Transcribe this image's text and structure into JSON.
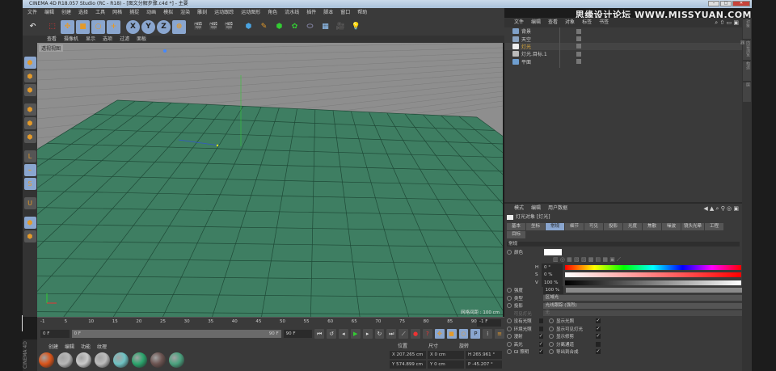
{
  "window": {
    "title": "CINEMA 4D R18.057 Studio (RC - R18) - [图文分解步骤.c4d *] - 主要",
    "watermark": "思缘设计论坛 WWW.MISSYUAN.COM"
  },
  "menu": [
    "文件",
    "编辑",
    "创建",
    "选择",
    "工具",
    "网格",
    "捕捉",
    "动画",
    "模拟",
    "渲染",
    "雕刻",
    "运动跟踪",
    "运动图形",
    "角色",
    "流水线",
    "插件",
    "脚本",
    "窗口",
    "帮助"
  ],
  "toolbar": {
    "axes": [
      "X",
      "Y",
      "Z"
    ],
    "icons": [
      "undo-icon",
      "live-select-icon",
      "move-icon",
      "scale-icon",
      "rotate-icon",
      "add-icon",
      "x-axis-icon",
      "y-axis-icon",
      "z-axis-icon",
      "world-coord-icon",
      "render-view-icon",
      "render-picture-icon",
      "render-settings-icon",
      "cube-icon",
      "pen-icon",
      "subdivision-icon",
      "array-icon",
      "deformer-icon",
      "floor-icon",
      "camera-icon",
      "light-icon"
    ]
  },
  "viewport": {
    "menu": [
      "查看",
      "摄像机",
      "显示",
      "选项",
      "过滤",
      "面板"
    ],
    "label": "透视视图",
    "grid_spacing": "网格间距 : 100 cm",
    "colors": {
      "sky": "#8e8e8e",
      "plane": "#3e7e62"
    }
  },
  "timeline": {
    "ticks": [
      "-1",
      "5",
      "10",
      "15",
      "20",
      "25",
      "30",
      "35",
      "40",
      "45",
      "50",
      "55",
      "60",
      "65",
      "70",
      "75",
      "80",
      "85",
      "90"
    ],
    "current_frame": "-1 F",
    "start": "0 F",
    "range_start": "0 F",
    "range_end": "90 F",
    "end": "90 F"
  },
  "materials": {
    "menu": [
      "创建",
      "编辑",
      "功能",
      "纹理"
    ],
    "swatches": [
      "#d9541a",
      "#b7b7b7",
      "#c9c9c9",
      "#bcbcbc",
      "#6fc3c4",
      "#2aa46c",
      "#6b5350",
      "#4aa17e"
    ]
  },
  "coordinates": {
    "headers": [
      "位置",
      "尺寸",
      "旋转"
    ],
    "rows": [
      {
        "a": "X",
        "pos": "207.265 cm",
        "b": "X",
        "size": "0 cm",
        "c": "H",
        "rot": "265.961 °"
      },
      {
        "a": "Y",
        "pos": "574.899 cm",
        "b": "Y",
        "size": "0 cm",
        "c": "P",
        "rot": "-45.207 °"
      }
    ]
  },
  "objects": {
    "menu": [
      "文件",
      "编辑",
      "查看",
      "对象",
      "标签",
      "书签"
    ],
    "items": [
      {
        "name": "背景",
        "color": "#7fa0c8",
        "selected": false
      },
      {
        "name": "天空",
        "color": "#8aa2c0",
        "selected": false
      },
      {
        "name": "灯光",
        "color": "#eeeeee",
        "selected": true
      },
      {
        "name": "灯光.目标.1",
        "color": "#bbbbbb",
        "selected": false
      },
      {
        "name": "平面",
        "color": "#6e9ed0",
        "selected": false
      }
    ]
  },
  "attributes": {
    "menu": [
      "模式",
      "编辑",
      "用户数据"
    ],
    "title": "灯光对象 [灯光]",
    "tabs": [
      "基本",
      "坐标",
      "常规",
      "细节",
      "可见",
      "投影",
      "光度",
      "焦散",
      "噪波",
      "镜头光晕",
      "工程",
      "目标"
    ],
    "active_tab": "常规",
    "section": "常规",
    "color_label": "颜色",
    "H": {
      "label": "H",
      "value": "0 °"
    },
    "S": {
      "label": "S",
      "value": "0 %"
    },
    "V": {
      "label": "V",
      "value": "100 %"
    },
    "intensity": {
      "label": "强度",
      "value": "100 %"
    },
    "type": {
      "label": "类型",
      "value": "区域光"
    },
    "shadow": {
      "label": "投影",
      "value": "光线跟踪 (强烈)"
    },
    "visible_light": {
      "label": "可见灯光",
      "value": "无"
    },
    "checks": [
      {
        "label": "没有光照",
        "checked": false
      },
      {
        "label": "显示光照",
        "checked": true
      },
      {
        "label": "环境光照",
        "checked": false
      },
      {
        "label": "显示可见灯光",
        "checked": true
      },
      {
        "label": "漫射",
        "checked": true
      },
      {
        "label": "显示修剪",
        "checked": true
      },
      {
        "label": "高光",
        "checked": true
      },
      {
        "label": "分离通道",
        "checked": false
      },
      {
        "label": "GI 照明",
        "checked": true
      },
      {
        "label": "导出到合成",
        "checked": true
      }
    ]
  },
  "right_tabs": [
    "对象",
    "内容浏览器",
    "构造",
    "层"
  ],
  "logo": "CINEMA 4D"
}
